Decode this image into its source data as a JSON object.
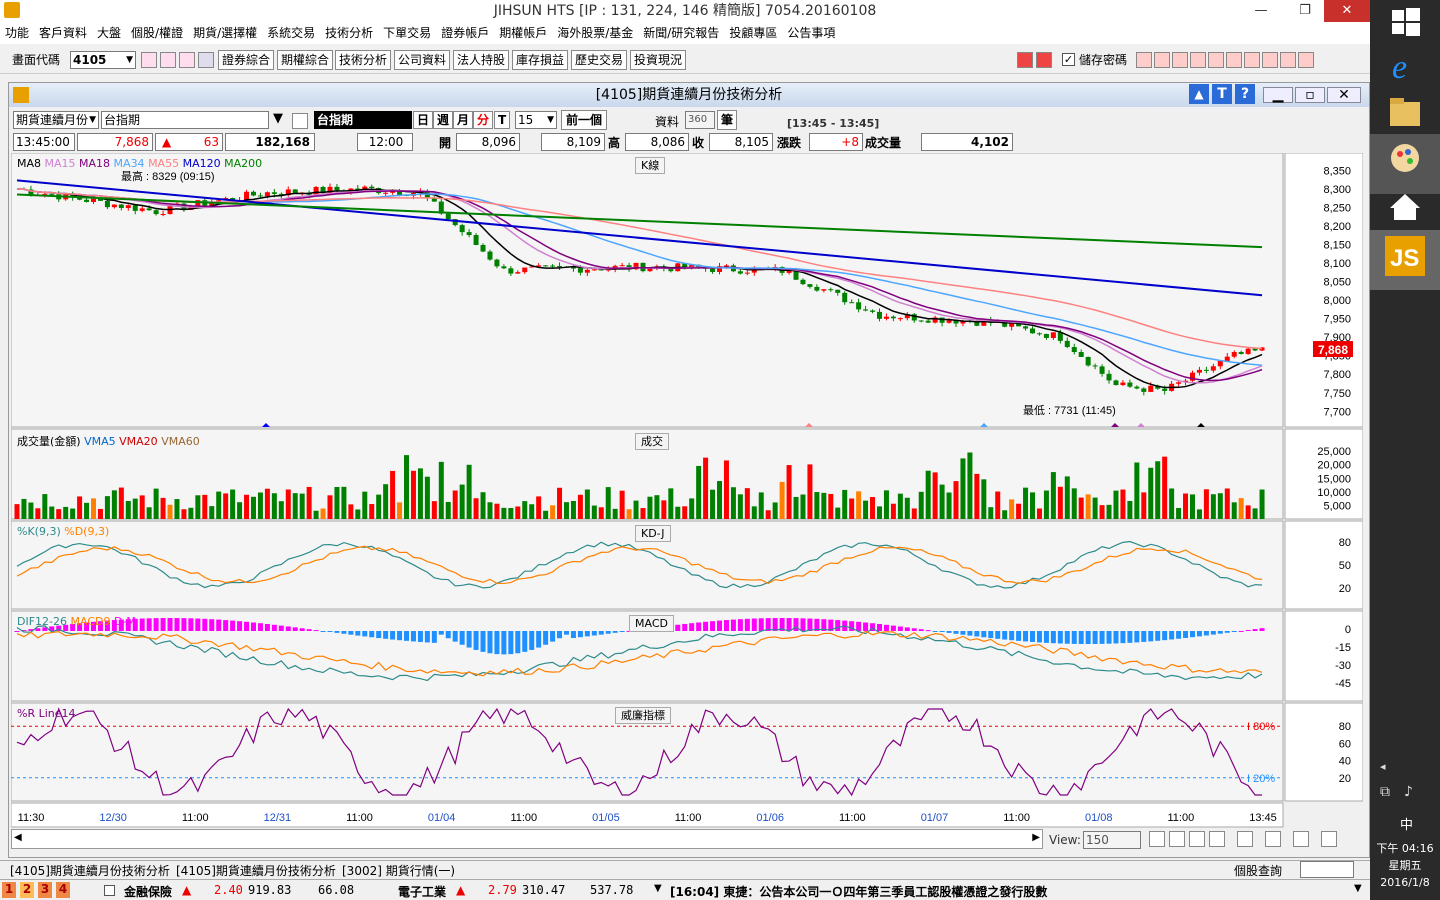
{
  "window": {
    "title": "JIHSUN HTS     [IP : 131, 224, 146 精簡版] 7054.20160108"
  },
  "menu": [
    "功能",
    "客戶資料",
    "大盤",
    "個股/權證",
    "期貨/選擇權",
    "系統交易",
    "技術分析",
    "下單交易",
    "證券帳戶",
    "期權帳戶",
    "海外股票/基金",
    "新聞/研究報告",
    "投顧專區",
    "公告事項"
  ],
  "toolbar": {
    "code_label": "畫面代碼",
    "code_value": "4105",
    "buttons": [
      "證券綜合",
      "期權綜合",
      "技術分析",
      "公司資料",
      "法人持股",
      "庫存損益",
      "歷史交易",
      "投資現況"
    ],
    "save_pw_label": "儲存密碼"
  },
  "child": {
    "title": "[4105]期貨連續月份技術分析",
    "period_select": "期貨連續月份",
    "product_field": "台指期",
    "product_name": "台指期",
    "tf_day": "日",
    "tf_week": "週",
    "tf_month": "月",
    "tf_min": "分",
    "tf_tick": "T",
    "interval": "15",
    "prev_btn": "前一個",
    "data_label": "資料",
    "data_count": "360",
    "data_unit": "筆",
    "time_range": "[13:45 - 13:45]"
  },
  "quote": {
    "time": "13:45:00",
    "price": "7,868",
    "change": "63",
    "volume": "182,168",
    "bar_time": "12:00",
    "open_label": "開",
    "open": "8,096",
    "high_label": "高",
    "high": "8,109",
    "low_label": "低",
    "low": "8,086",
    "close_label": "收",
    "close": "8,105",
    "chg_label": "漲跌",
    "chg": "+8",
    "vol_label": "成交量",
    "vol": "4,102"
  },
  "panels": {
    "kline": {
      "tab": "K線",
      "legend": [
        {
          "t": "MA8",
          "c": "#000000"
        },
        {
          "t": "MA15",
          "c": "#d080d0"
        },
        {
          "t": "MA18",
          "c": "#800080"
        },
        {
          "t": "MA34",
          "c": "#4da6ff"
        },
        {
          "t": "MA55",
          "c": "#ff8080"
        },
        {
          "t": "MA120",
          "c": "#0000cc"
        },
        {
          "t": "MA200",
          "c": "#008000"
        }
      ],
      "high_note": "最高 : 8329 (09:15)",
      "low_note": "最低 : 7731 (11:45)",
      "last_price": "7,868",
      "yticks": [
        "8,350",
        "8,300",
        "8,250",
        "8,200",
        "8,150",
        "8,100",
        "8,050",
        "8,000",
        "7,950",
        "7,900",
        "7,850",
        "7,800",
        "7,750",
        "7,700"
      ]
    },
    "volume": {
      "tab": "成交",
      "legend": [
        {
          "t": "成交量(金額)",
          "c": "#000000"
        },
        {
          "t": "VMA5",
          "c": "#0066cc"
        },
        {
          "t": "VMA20",
          "c": "#cc0000"
        },
        {
          "t": "VMA60",
          "c": "#996633"
        }
      ],
      "yticks": [
        "25,000",
        "20,000",
        "15,000",
        "10,000",
        "5,000"
      ]
    },
    "kd": {
      "tab": "KD-J",
      "legend": [
        {
          "t": "%K(9,3)",
          "c": "#2e8b8b"
        },
        {
          "t": "%D(9,3)",
          "c": "#ff8000"
        }
      ],
      "yticks": [
        "80",
        "50",
        "20"
      ]
    },
    "macd": {
      "tab": "MACD",
      "legend": [
        {
          "t": "DIF12-26",
          "c": "#2e8b8b"
        },
        {
          "t": "MACD9",
          "c": "#ff8000"
        },
        {
          "t": "D-M",
          "c": "#ff00ff"
        }
      ],
      "yticks": [
        "0",
        "-15",
        "-30",
        "-45"
      ]
    },
    "wr": {
      "tab": "威廉指標",
      "legend": [
        {
          "t": "%R Line14",
          "c": "#800080"
        }
      ],
      "yticks": [
        "80",
        "60",
        "40",
        "20"
      ],
      "hi_label": "80%",
      "lo_label": "20%"
    }
  },
  "xaxis": [
    "11:30",
    "12/30",
    "11:00",
    "12/31",
    "11:00",
    "01/04",
    "11:00",
    "01/05",
    "11:00",
    "01/06",
    "11:00",
    "01/07",
    "11:00",
    "01/08",
    "11:00",
    "13:45"
  ],
  "view_label": "View:",
  "view_value": "150",
  "bottom_tabs": [
    "[4105]期貨連續月份技術分析",
    "[4105]期貨連續月份技術分析",
    "[3002] 期貨行情(一)"
  ],
  "stock_query": "個股查詢",
  "ticker": {
    "tabs": [
      "1",
      "2",
      "3",
      "4"
    ],
    "item1_name": "金融保險",
    "item1_chg": "2.40",
    "item1_idx": "919.83",
    "item1_vol": "66.08",
    "item2_name": "電子工業",
    "item2_chg": "2.79",
    "item2_idx": "310.47",
    "item2_vol": "537.78",
    "news": "[16:04] 東捷：公告本公司一Ｏ四年第三季員工認股權憑證之發行股數"
  },
  "clock": {
    "time": "下午 04:16",
    "weekday": "星期五",
    "date": "2016/1/8"
  },
  "ime": "中"
}
